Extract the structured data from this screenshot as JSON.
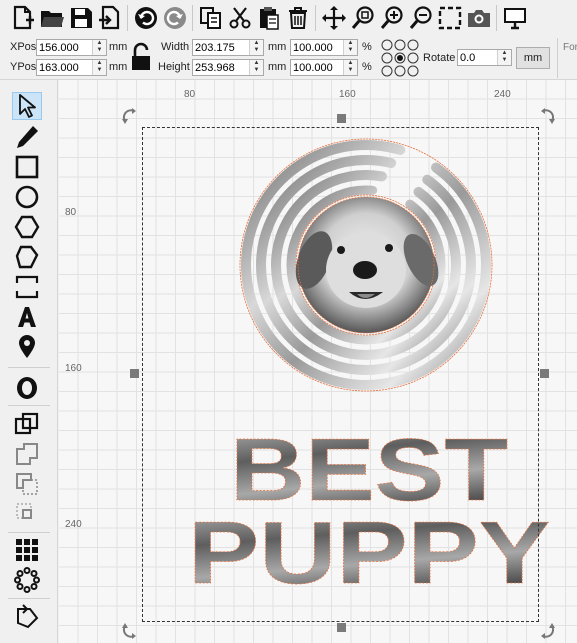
{
  "toolbar": {
    "buttons": [
      {
        "name": "new-icon"
      },
      {
        "name": "open-icon"
      },
      {
        "name": "save-icon"
      },
      {
        "name": "import-icon"
      },
      {
        "name": "undo-icon"
      },
      {
        "name": "redo-icon"
      },
      {
        "name": "copy-icon"
      },
      {
        "name": "cut-icon"
      },
      {
        "name": "paste-icon"
      },
      {
        "name": "delete-icon"
      },
      {
        "name": "move-icon"
      },
      {
        "name": "zoom-selection-icon"
      },
      {
        "name": "zoom-in-icon"
      },
      {
        "name": "zoom-out-icon"
      },
      {
        "name": "frame-selection-icon"
      },
      {
        "name": "camera-icon"
      },
      {
        "name": "monitor-icon"
      }
    ]
  },
  "properties": {
    "xpos_label": "XPos",
    "xpos_value": "156.000",
    "ypos_label": "YPos",
    "ypos_value": "163.000",
    "pos_unit": "mm",
    "width_label": "Width",
    "width_value": "203.175",
    "height_label": "Height",
    "height_value": "253.968",
    "size_unit": "mm",
    "width_percent": "100.000",
    "height_percent": "100.000",
    "percent_unit": "%",
    "rotate_label": "Rotate",
    "rotate_value": "0.0",
    "units_button": "mm",
    "cut_panel_label": "For"
  },
  "tools": [
    {
      "name": "select-tool-icon"
    },
    {
      "name": "pencil-tool-icon"
    },
    {
      "name": "rectangle-tool-icon"
    },
    {
      "name": "ellipse-tool-icon"
    },
    {
      "name": "polygon-tool-icon"
    },
    {
      "name": "pentagon-tool-icon"
    },
    {
      "name": "position-lasers-tool-icon"
    },
    {
      "name": "text-tool-icon"
    },
    {
      "name": "map-pin-tool-icon"
    },
    {
      "name": "offset-tool-icon"
    },
    {
      "name": "weld-tool-icon"
    },
    {
      "name": "union-tool-icon"
    },
    {
      "name": "subtract-tool-icon"
    },
    {
      "name": "intersect-tool-icon"
    },
    {
      "name": "grid-array-tool-icon"
    },
    {
      "name": "circular-array-tool-icon"
    },
    {
      "name": "node-edit-tool-icon"
    }
  ],
  "canvas": {
    "ruler_top": [
      "80",
      "160",
      "240"
    ],
    "ruler_left": [
      "80",
      "160",
      "240"
    ],
    "art_text_line1": "BEST",
    "art_text_line2": "PUPPY",
    "accent_outline_color": "#e8703a"
  }
}
